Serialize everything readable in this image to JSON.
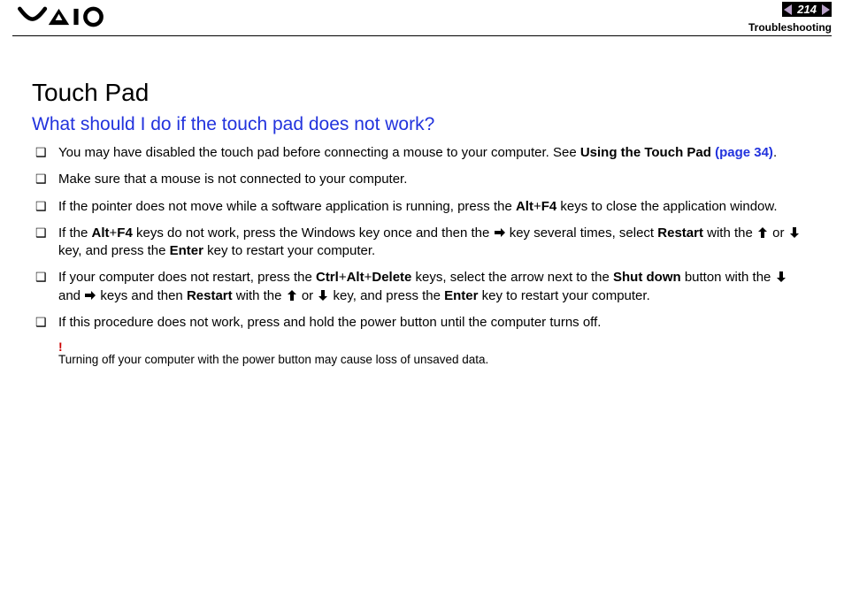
{
  "header": {
    "page_number": "214",
    "section": "Troubleshooting"
  },
  "title": "Touch Pad",
  "question": "What should I do if the touch pad does not work?",
  "items": [
    {
      "pre": "You may have disabled the touch pad before connecting a mouse to your computer. See ",
      "bold1": "Using the Touch Pad ",
      "link": "(page 34)",
      "post": "."
    },
    {
      "text": "Make sure that a mouse is not connected to your computer."
    },
    {
      "pre": "If the pointer does not move while a software application is running, press the ",
      "b1": "Alt",
      "plus1": "+",
      "b2": "F4",
      "post": " keys to close the application window."
    },
    {
      "pre": "If the ",
      "b1": "Alt",
      "plus1": "+",
      "b2": "F4",
      "mid1": " keys do not work, press the Windows key once and then the ",
      "arrow1": "right",
      "mid2": " key several times, select ",
      "b3": "Restart",
      "mid3": " with the ",
      "arrow2": "up",
      "mid4": " or ",
      "arrow3": "down",
      "mid5": " key, and press the ",
      "b4": "Enter",
      "post": " key to restart your computer."
    },
    {
      "pre": "If your computer does not restart, press the ",
      "b1": "Ctrl",
      "plus1": "+",
      "b2": "Alt",
      "plus2": "+",
      "b3": "Delete",
      "mid1": " keys, select the arrow next to the ",
      "b4": "Shut down",
      "mid2": " button with the ",
      "arrow1": "down",
      "mid3": " and ",
      "arrow2": "right",
      "mid4": " keys and then ",
      "b5": "Restart",
      "mid5": " with the ",
      "arrow3": "up",
      "mid6": " or ",
      "arrow4": "down",
      "mid7": " key, and press the ",
      "b6": "Enter",
      "post": " key to restart your computer."
    },
    {
      "text": "If this procedure does not work, press and hold the power button until the computer turns off."
    }
  ],
  "note": {
    "bang": "!",
    "text": "Turning off your computer with the power button may cause loss of unsaved data."
  }
}
